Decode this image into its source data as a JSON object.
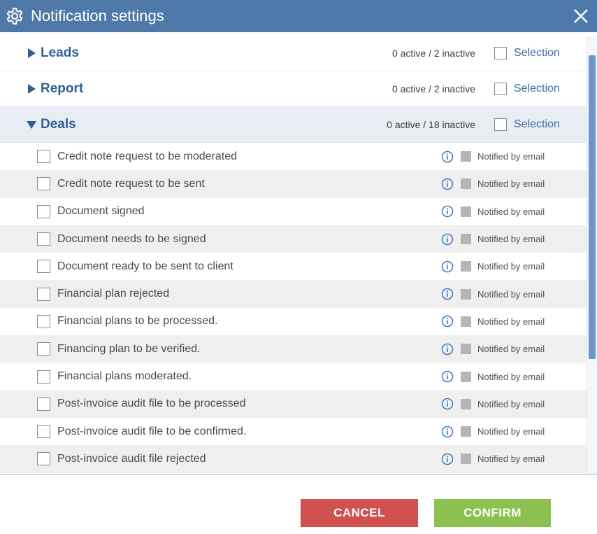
{
  "dialog": {
    "title": "Notification settings",
    "title_icon": "gear-icon",
    "close_icon": "close-icon"
  },
  "sections": [
    {
      "name": "Leads",
      "expanded": false,
      "count": "0 active / 2 inactive",
      "selection_label": "Selection"
    },
    {
      "name": "Report",
      "expanded": false,
      "count": "0 active / 2 inactive",
      "selection_label": "Selection"
    },
    {
      "name": "Deals",
      "expanded": true,
      "count": "0 active / 18 inactive",
      "selection_label": "Selection"
    }
  ],
  "deals_items": [
    {
      "label": "Credit note request to be moderated",
      "email_label": "Notified by email"
    },
    {
      "label": "Credit note request to be sent",
      "email_label": "Notified by email"
    },
    {
      "label": "Document signed",
      "email_label": "Notified by email"
    },
    {
      "label": "Document needs to be signed",
      "email_label": "Notified by email"
    },
    {
      "label": "Document ready to be sent to client",
      "email_label": "Notified by email"
    },
    {
      "label": "Financial plan rejected",
      "email_label": "Notified by email"
    },
    {
      "label": "Financial plans to be processed.",
      "email_label": "Notified by email"
    },
    {
      "label": "Financing plan to be verified.",
      "email_label": "Notified by email"
    },
    {
      "label": "Financial plans moderated.",
      "email_label": "Notified by email"
    },
    {
      "label": "Post-invoice audit file to be processed",
      "email_label": "Notified by email"
    },
    {
      "label": "Post-invoice audit file to be confirmed.",
      "email_label": "Notified by email"
    },
    {
      "label": "Post-invoice audit file rejected",
      "email_label": "Notified by email"
    }
  ],
  "footer": {
    "cancel_label": "CANCEL",
    "confirm_label": "CONFIRM"
  },
  "colors": {
    "header_bar": "#4d78a8",
    "section_title": "#2f5f93",
    "link": "#3b6ea8",
    "cancel": "#d0514f",
    "confirm": "#8cc152",
    "info_icon": "#3b7bc0"
  }
}
